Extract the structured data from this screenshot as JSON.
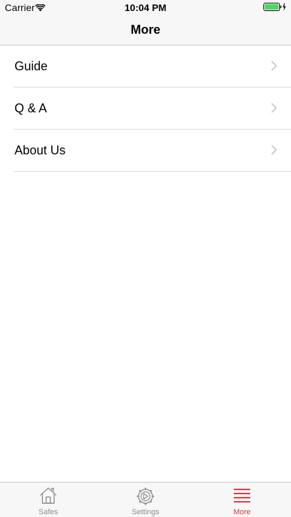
{
  "status_bar": {
    "carrier": "Carrier",
    "time": "10:04 PM",
    "wifi_icon": "wifi-icon",
    "battery_icon": "battery-charging-icon",
    "battery_color": "#4cd964"
  },
  "nav": {
    "title": "More"
  },
  "menu": {
    "items": [
      {
        "label": "Guide",
        "icon": "chevron-right-icon"
      },
      {
        "label": "Q & A",
        "icon": "chevron-right-icon"
      },
      {
        "label": "About Us",
        "icon": "chevron-right-icon"
      }
    ]
  },
  "tab_bar": {
    "active_color": "#e0393e",
    "inactive_color": "#8e8e93",
    "tabs": [
      {
        "label": "Safes",
        "icon": "house-icon",
        "active": false
      },
      {
        "label": "Settings",
        "icon": "gear-icon",
        "active": false
      },
      {
        "label": "More",
        "icon": "menu-icon",
        "active": true
      }
    ]
  }
}
